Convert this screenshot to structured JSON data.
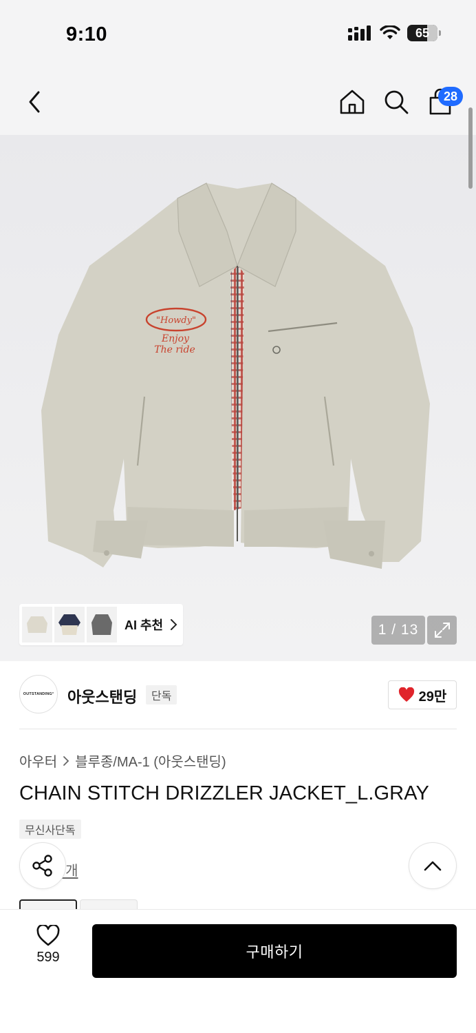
{
  "status_bar": {
    "time": "9:10",
    "battery": "65",
    "battery_level": 0.65
  },
  "nav": {
    "cart_count": "28"
  },
  "gallery": {
    "ai_recommend_label": "AI 추천",
    "page_counter": "1 / 13",
    "embroidery_line1": "\"Howdy\"",
    "embroidery_line2": "Enjoy",
    "embroidery_line3": "The ride"
  },
  "brand": {
    "logo_text": "OUTSTANDING°",
    "name": "아웃스탠딩",
    "tag": "단독",
    "likes": "29만"
  },
  "product": {
    "breadcrumb": [
      "아우터",
      "블루종/MA-1 (아웃스탠딩)"
    ],
    "title": "CHAIN STITCH DRIZZLER JACKET_L.GRAY",
    "exclusive_tag": "무신사단독",
    "review_link": "기 5개"
  },
  "bottom_bar": {
    "wish_count": "599",
    "buy_label": "구매하기"
  },
  "colors": {
    "accent_blue": "#1f6bff",
    "heart_red": "#e0242b",
    "jacket": "#d3d1c5",
    "embroidery": "#c8432e"
  },
  "icons": [
    "back-arrow-icon",
    "home-icon",
    "search-icon",
    "shopping-bag-icon",
    "chevron-right-icon",
    "expand-icon",
    "heart-filled-icon",
    "share-icon",
    "chevron-up-icon",
    "heart-outline-icon",
    "signal-icon",
    "wifi-icon"
  ]
}
